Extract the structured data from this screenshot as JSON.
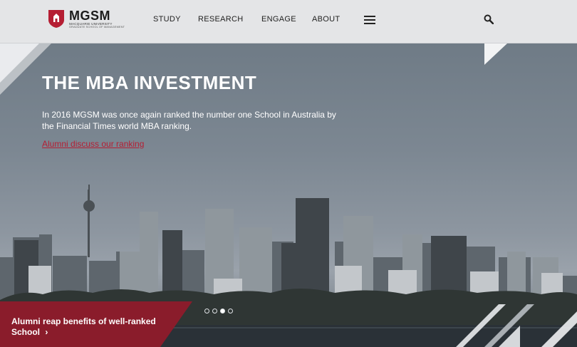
{
  "header": {
    "logo": {
      "name": "MGSM",
      "subtitle": "MACQUARIE UNIVERSITY",
      "subtitle2": "GRADUATE SCHOOL OF MANAGEMENT"
    },
    "nav": [
      {
        "label": "STUDY"
      },
      {
        "label": "RESEARCH"
      },
      {
        "label": "ENGAGE"
      },
      {
        "label": "ABOUT"
      }
    ],
    "icons": {
      "menu": "hamburger-menu-icon",
      "search": "search-icon"
    }
  },
  "hero": {
    "title": "THE MBA INVESTMENT",
    "text": "In 2016 MGSM was once again ranked the number one School in Australia by the Financial Times world MBA ranking.",
    "link": "Alumni discuss our ranking",
    "caption": "Alumni reap benefits of well-ranked School",
    "caption_arrow": "›",
    "slides": {
      "count": 4,
      "active": 3
    }
  },
  "colors": {
    "header_bg": "#e4e5e7",
    "brand_red": "#b51e33",
    "caption_bg": "#8a1c2b",
    "hero_text": "#ffffff"
  }
}
